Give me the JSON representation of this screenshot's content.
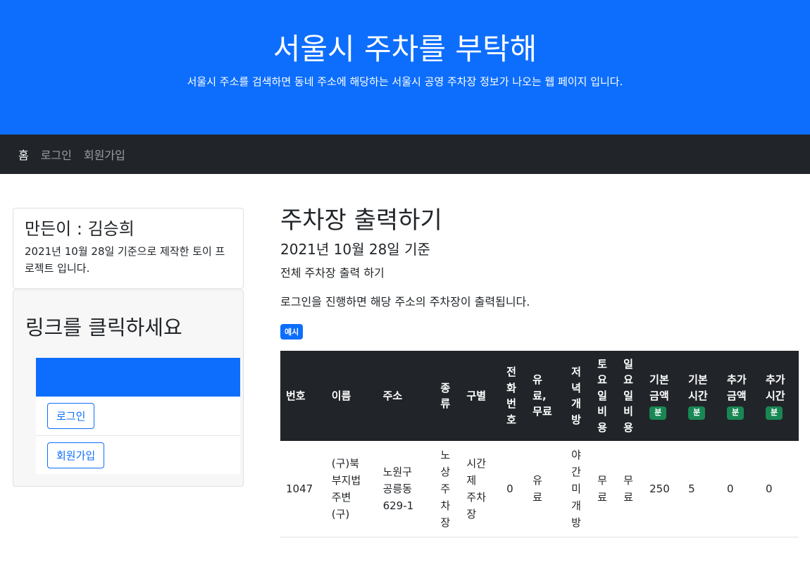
{
  "header": {
    "title": "서울시 주차를 부탁해",
    "subtitle": "서울시 주소를 검색하면 동네 주소에 해당하는 서울시 공영 주차장 정보가 나오는 웹 페이지 입니다."
  },
  "nav": {
    "home": "홈",
    "login": "로그인",
    "signup": "회원가입"
  },
  "sidebar": {
    "author_title": "만든이 : 김승희",
    "author_desc": "2021년 10월 28일 기준으로 제작한 토이 프로젝트 입니다.",
    "links_title": "링크를 클릭하세요",
    "login_button": "로그인",
    "signup_button": "회원가입"
  },
  "main": {
    "title": "주차장 출력하기",
    "date": "2021년 10월 28일 기준",
    "sub": "전체 주차장 출력 하기",
    "note": "로그인을 진행하면 해당 주소의 주차장이 출력됩니다.",
    "example_badge": "예시"
  },
  "table": {
    "headers": {
      "num": "번호",
      "name": "이름",
      "addr": "주소",
      "kind": "종류",
      "type": "구별",
      "phone": "전화번호",
      "paid": "유료,무료",
      "night": "저녁개방",
      "sat": "토요일비용",
      "sun": "일요일비용",
      "base_fee": "기본금액",
      "base_time": "기본시간",
      "add_fee": "추가금액",
      "add_time": "추가시간",
      "unit": "분"
    },
    "row": {
      "num": "1047",
      "name": "(구)북부지법주변(구)",
      "addr": "노원구 공릉동 629-1",
      "kind": "노상주차장",
      "type": "시간제 주차장",
      "phone": "0",
      "paid": "유료",
      "night": "야간미개방",
      "sat": "무료",
      "sun": "무료",
      "base_fee": "250",
      "base_time": "5",
      "add_fee": "0",
      "add_time": "0"
    }
  }
}
